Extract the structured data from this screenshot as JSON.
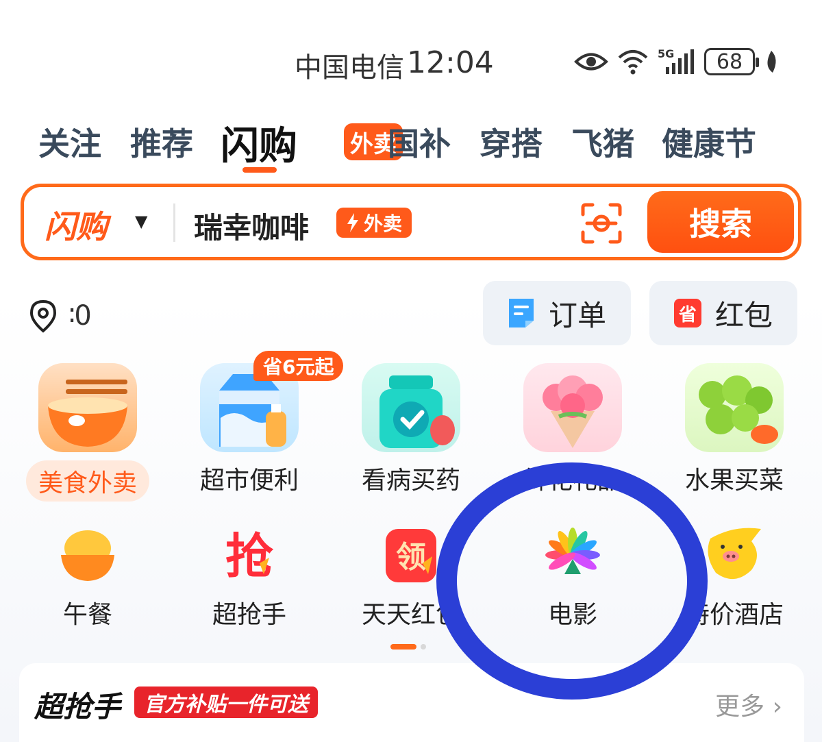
{
  "status_bar": {
    "carrier": "中国电信",
    "time": "12:04",
    "battery": "68",
    "icons": [
      "eye-icon",
      "wifi-icon",
      "5g-signal-icon",
      "battery-icon",
      "leaf-icon"
    ]
  },
  "tabs": {
    "items": [
      "关注",
      "推荐",
      "闪购",
      "国补",
      "穿搭",
      "飞猪",
      "健康节"
    ],
    "active": "闪购",
    "badge": "外卖"
  },
  "search": {
    "brand": "闪购",
    "query": "瑞幸咖啡",
    "query_badge": "外卖",
    "button": "搜索"
  },
  "location": {
    "text": "∶0"
  },
  "quick_links": {
    "orders": "订单",
    "red_packet": "红包",
    "red_packet_icon_char": "省"
  },
  "categories": [
    {
      "label": "美食外卖",
      "icon": "noodle-bowl-icon"
    },
    {
      "label": "超市便利",
      "icon": "milk-carton-icon",
      "tag": "省6元起"
    },
    {
      "label": "看病买药",
      "icon": "medicine-bottle-icon"
    },
    {
      "label": "鲜花礼品",
      "icon": "flower-bouquet-icon"
    },
    {
      "label": "水果买菜",
      "icon": "grapes-icon"
    }
  ],
  "small_categories": [
    {
      "label": "午餐",
      "icon": "rice-bowl-icon"
    },
    {
      "label": "超抢手",
      "icon": "grab-icon",
      "glyph": "抢"
    },
    {
      "label": "天天红包",
      "icon": "collect-icon",
      "glyph": "领"
    },
    {
      "label": "电影",
      "icon": "movie-flower-icon"
    },
    {
      "label": "特价酒店",
      "icon": "pig-icon"
    }
  ],
  "promo": {
    "title": "超抢手",
    "tag": "官方补贴一件可送",
    "more": "更多 ›"
  },
  "colors": {
    "accent": "#ff5a1a",
    "annotation": "#2b3fd6"
  }
}
